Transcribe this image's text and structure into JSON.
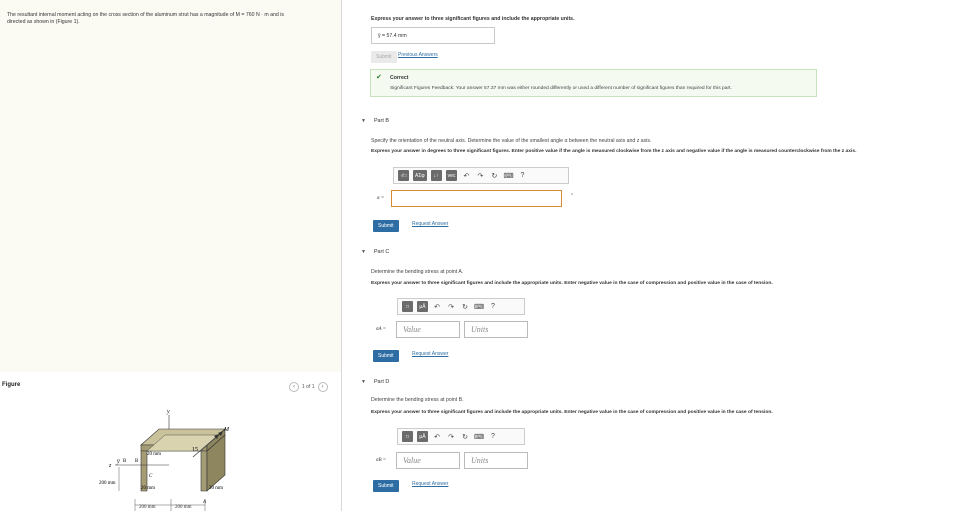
{
  "problem": {
    "line1": "The resultant internal moment acting on the cross section of the aluminum strut has a magnitude of M = 760 N · m and is",
    "line2": "directed as shown in (Figure 1)."
  },
  "figure": {
    "label": "Figure",
    "pager": "1 of 1",
    "dims": {
      "d200a": "200 mm",
      "d200b": "200 mm",
      "d200c": "200 mm",
      "d20a": "20 mm",
      "d20b": "20 mm",
      "d20c": "20 mm",
      "n15": "15",
      "z": "z",
      "y": "y",
      "M": "M",
      "B": "B",
      "C": "C",
      "A": "A",
      "zbar": "y̅"
    }
  },
  "partA": {
    "instruction": "Express your answer to three significant figures and include the appropriate units.",
    "answer": "ȳ =  57.4 mm",
    "submit": "Submit",
    "previous": "Previous Answers",
    "correct_title": "Correct",
    "feedback": "Significant Figures Feedback: Your answer 57.37 mm was either rounded differently or used a different number of significant figures than required for this part."
  },
  "partB": {
    "title": "Part B",
    "line1": "Specify the orientation of the neutral axis. Determine the value of the smallest angle α between the neutral axis and z axis.",
    "line2": "Express your answer in degrees to three significant figures. Enter positive value if the angle is measured clockwise from the z axis and negative value if the angle is measured counterclockwise from the z axis.",
    "tb1": "√□",
    "tb2": "AΣφ",
    "tb3": "↓↑",
    "tb4": "vec",
    "symbol": "α =",
    "unit": "°",
    "submit": "Submit",
    "request": "Request Answer"
  },
  "partC": {
    "title": "Part C",
    "line1": "Determine the bending stress at point A.",
    "line2": "Express your answer to three significant figures and include the appropriate units. Enter negative value in the case of compression and positive value in the case of tension.",
    "tb1": "□",
    "tb2": "μÅ",
    "symbol": "σA =",
    "value_placeholder": "Value",
    "units_placeholder": "Units",
    "submit": "Submit",
    "request": "Request Answer"
  },
  "partD": {
    "title": "Part D",
    "line1": "Determine the bending stress at point B.",
    "line2": "Express your answer to three significant figures and include the appropriate units. Enter negative value in the case of compression and positive value in the case of tension.",
    "tb1": "□",
    "tb2": "μÅ",
    "symbol": "σB =",
    "value_placeholder": "Value",
    "units_placeholder": "Units",
    "submit": "Submit",
    "request": "Request Answer"
  },
  "colors": {
    "submit_blue": "#2e6da4",
    "correct_green": "#2e7d32",
    "orange_focus": "#d88a2e",
    "figure_fill": "#b7b08a"
  }
}
